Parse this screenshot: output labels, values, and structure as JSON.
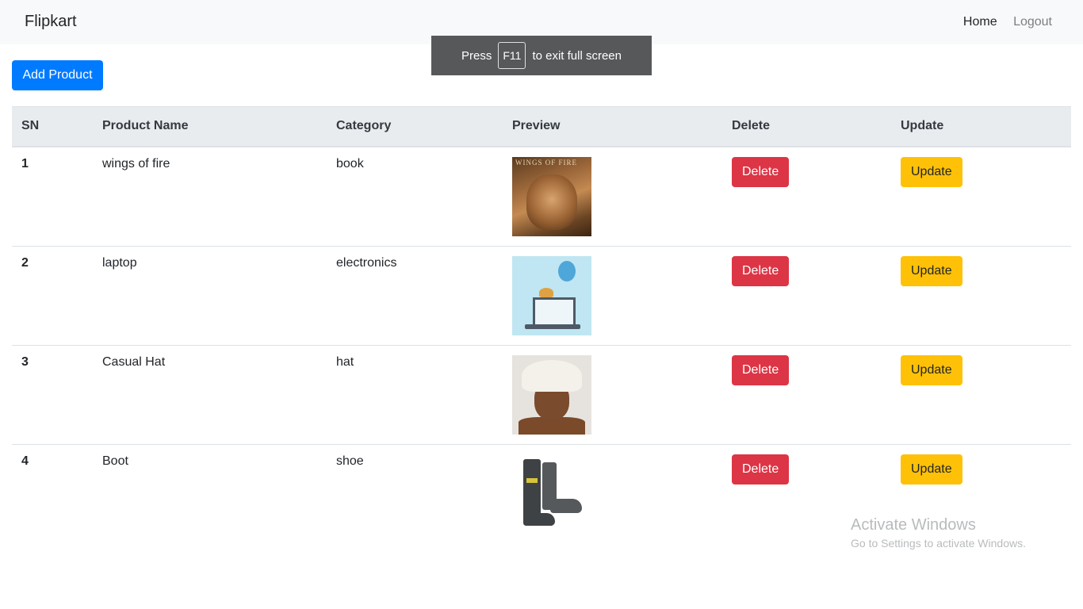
{
  "navbar": {
    "brand": "Flipkart",
    "links": [
      "Home",
      "Logout"
    ]
  },
  "fullscreen_toast": {
    "pre": "Press",
    "key": "F11",
    "post": "to exit full screen"
  },
  "toolbar": {
    "add_label": "Add Product"
  },
  "table": {
    "headers": [
      "SN",
      "Product Name",
      "Category",
      "Preview",
      "Delete",
      "Update"
    ],
    "rows": [
      {
        "sn": "1",
        "name": "wings of fire",
        "category": "book",
        "preview": "book-cover-image",
        "delete_label": "Delete",
        "update_label": "Update"
      },
      {
        "sn": "2",
        "name": "laptop",
        "category": "electronics",
        "preview": "laptop-illustration-image",
        "delete_label": "Delete",
        "update_label": "Update"
      },
      {
        "sn": "3",
        "name": "Casual Hat",
        "category": "hat",
        "preview": "hat-photo-image",
        "delete_label": "Delete",
        "update_label": "Update"
      },
      {
        "sn": "4",
        "name": "Boot",
        "category": "shoe",
        "preview": "boot-photo-image",
        "delete_label": "Delete",
        "update_label": "Update"
      }
    ]
  },
  "watermark": {
    "title": "Activate Windows",
    "subtitle": "Go to Settings to activate Windows."
  },
  "colors": {
    "primary": "#007bff",
    "danger": "#dc3545",
    "warning": "#ffc107",
    "navbar_bg": "#f8f9fa",
    "header_bg": "#e9ecef"
  }
}
